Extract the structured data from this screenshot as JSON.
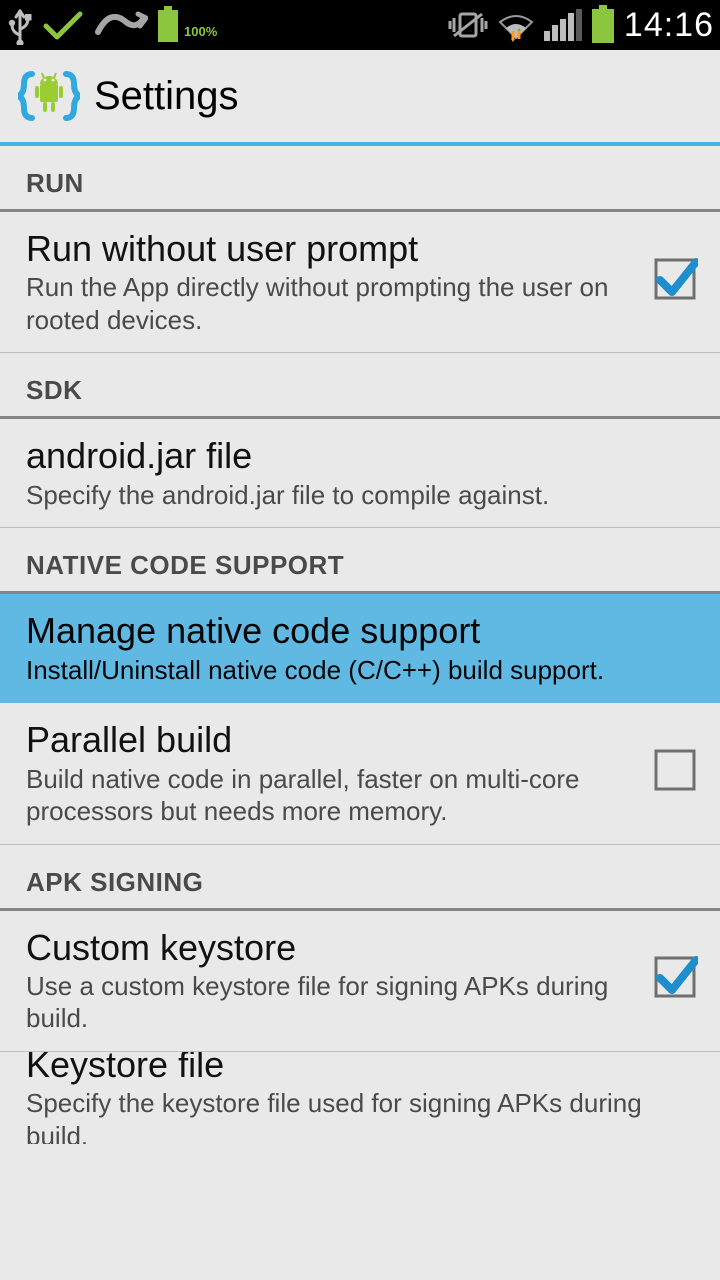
{
  "status": {
    "battery_pct_label": "100%",
    "clock": "14:16"
  },
  "action_bar": {
    "title": "Settings"
  },
  "sections": {
    "run": {
      "header": "RUN",
      "run_no_prompt": {
        "title": "Run without user prompt",
        "summary": "Run the App directly without prompting the user on rooted devices.",
        "checked": true
      }
    },
    "sdk": {
      "header": "SDK",
      "android_jar": {
        "title": "android.jar file",
        "summary": "Specify the android.jar file to compile against."
      }
    },
    "native": {
      "header": "NATIVE CODE SUPPORT",
      "manage": {
        "title": "Manage native code support",
        "summary": "Install/Uninstall native code (C/C++) build support."
      },
      "parallel": {
        "title": "Parallel build",
        "summary": "Build native code in parallel, faster on multi-core processors but needs more memory.",
        "checked": false
      }
    },
    "signing": {
      "header": "APK SIGNING",
      "custom_keystore": {
        "title": "Custom keystore",
        "summary": "Use a custom keystore file for signing APKs during build.",
        "checked": true
      },
      "keystore_file": {
        "title": "Keystore file",
        "summary": "Specify the keystore file used for signing APKs during build."
      }
    }
  }
}
